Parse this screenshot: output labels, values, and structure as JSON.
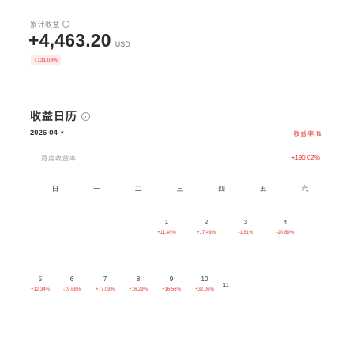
{
  "header": {
    "label": "累计收益",
    "pnl_value": "+4,463.20",
    "pnl_unit": "USD",
    "change_pct": "131.08%",
    "change_arrow": "↑"
  },
  "section": {
    "title": "收益日历",
    "month": "2026-04",
    "toggle_label": "收益率",
    "rate_label": "月度收益率",
    "rate_value": "+190.02%"
  },
  "weekdays": [
    "日",
    "一",
    "二",
    "三",
    "四",
    "五",
    "六"
  ],
  "week1": [
    {
      "day": "1",
      "pct": "+11.40%"
    },
    {
      "day": "2",
      "pct": "+17.49%"
    },
    {
      "day": "3",
      "pct": "-1.81%"
    },
    {
      "day": "4",
      "pct": "-20.89%"
    }
  ],
  "week2": [
    {
      "day": "5",
      "pct": "+12.34%"
    },
    {
      "day": "6",
      "pct": "-19.68%"
    },
    {
      "day": "7",
      "pct": "+77.09%"
    },
    {
      "day": "8",
      "pct": "+16.29%"
    },
    {
      "day": "9",
      "pct": "+16.56%"
    },
    {
      "day": "10",
      "pct": "+32.06%"
    }
  ],
  "week2_extra": "11",
  "colors": {
    "accent": "#e2342f",
    "badge_bg": "#fdeaea"
  }
}
